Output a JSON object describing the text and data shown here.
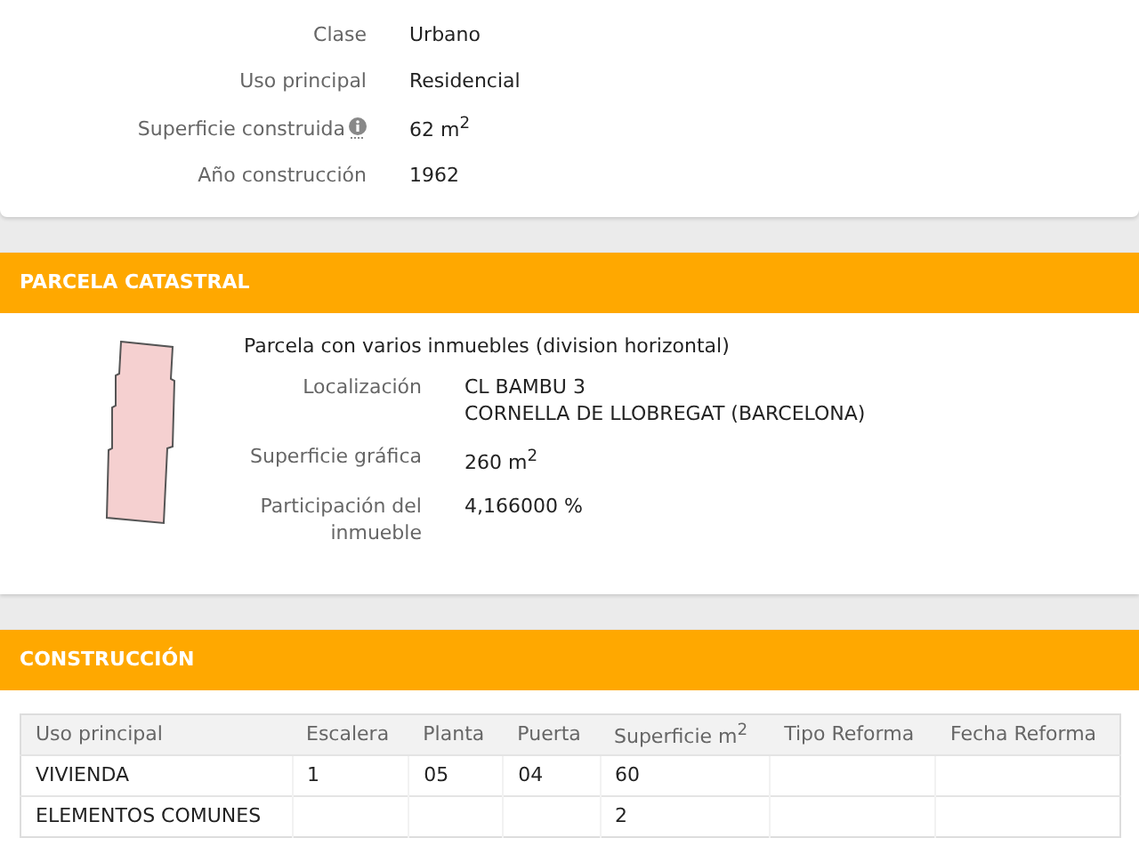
{
  "inmueble": {
    "rows": [
      {
        "label": "Clase",
        "value": "Urbano",
        "info": false
      },
      {
        "label": "Uso principal",
        "value": "Residencial",
        "info": false
      },
      {
        "label": "Superficie construida",
        "value": "62 m$^{2}$",
        "info": true
      },
      {
        "label": "Año construcción",
        "value": "1962",
        "info": false
      }
    ]
  },
  "parcela": {
    "title": "PARCELA CATASTRAL",
    "description": "Parcela con varios inmuebles (division horizontal)",
    "rows": [
      {
        "label": "Localización",
        "lines": [
          "CL BAMBU 3",
          "CORNELLA DE LLOBREGAT (BARCELONA)"
        ]
      },
      {
        "label": "Superficie gráfica",
        "lines": [
          "260 m$^{2}$"
        ]
      },
      {
        "label": "Participación del inmueble",
        "lines": [
          "4,166000 %"
        ]
      }
    ]
  },
  "construccion": {
    "title": "CONSTRUCCIÓN",
    "columns": [
      "Uso principal",
      "Escalera",
      "Planta",
      "Puerta",
      "Superficie m$^{2}$",
      "Tipo Reforma",
      "Fecha Reforma"
    ],
    "rows": [
      [
        "VIVIENDA",
        "1",
        "05",
        "04",
        "60",
        "",
        ""
      ],
      [
        "ELEMENTOS COMUNES",
        "",
        "",
        "",
        "2",
        "",
        ""
      ]
    ]
  }
}
